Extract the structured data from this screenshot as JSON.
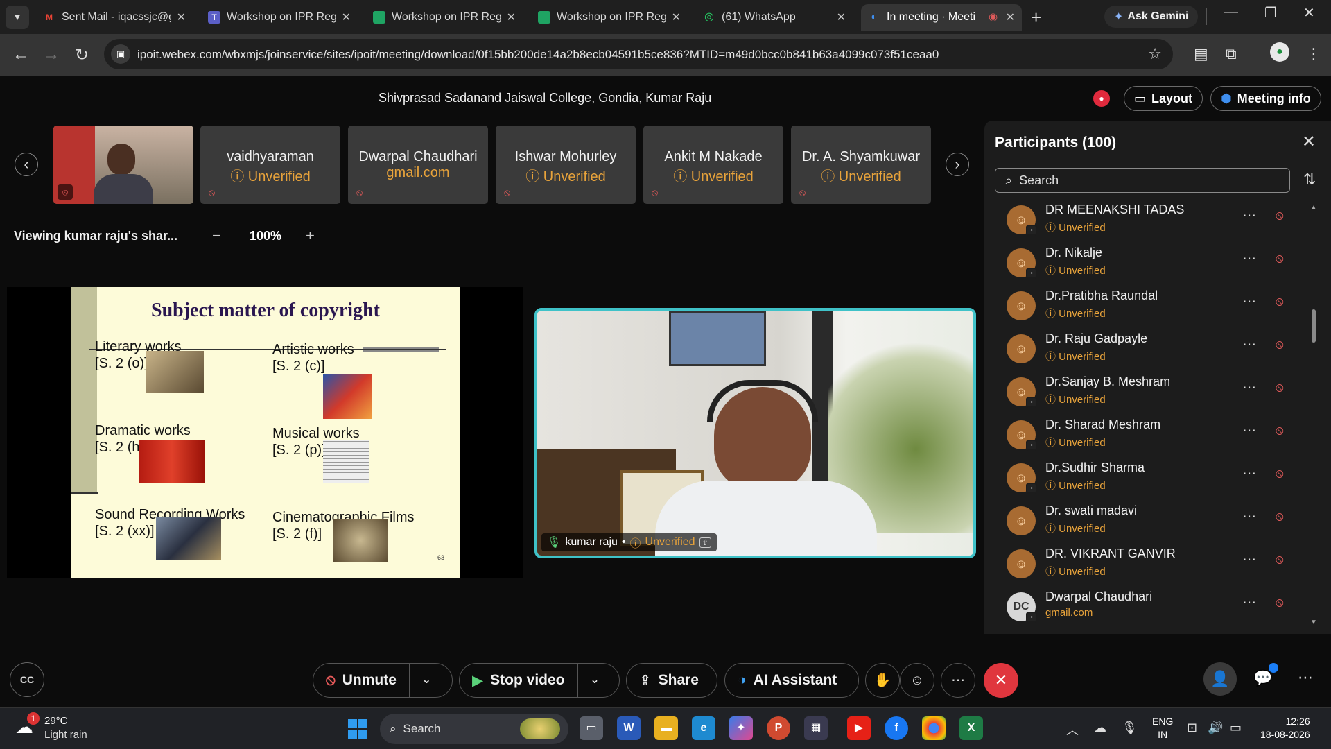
{
  "browser": {
    "tabs": [
      {
        "title": "Sent Mail - iqacssjc@g",
        "icon": "gmail-icon"
      },
      {
        "title": "Workshop on IPR Regi",
        "icon": "teams-icon"
      },
      {
        "title": "Workshop on IPR Regi",
        "icon": "sheets-icon"
      },
      {
        "title": "Workshop on IPR Regi",
        "icon": "sheets-icon"
      },
      {
        "title": "(61) WhatsApp",
        "icon": "whatsapp-icon"
      },
      {
        "title": "In meeting · Meeti",
        "icon": "webex-icon"
      }
    ],
    "gemini_label": "Ask Gemini",
    "url": "ipoit.webex.com/wbxmjs/joinservice/sites/ipoit/meeting/download/0f15bb200de14a2b8ecb04591b5ce836?MTID=m49d0bcc0b841b63a4099c073f51ceaa0"
  },
  "meeting": {
    "title": "Shivprasad Sadanand Jaiswal College, Gondia, Kumar Raju",
    "layout_label": "Layout",
    "info_label": "Meeting info",
    "filmstrip": [
      {
        "name": "vaidhyaraman",
        "status": "Unverified"
      },
      {
        "name": "Dwarpal Chaudhari",
        "status": "gmail.com"
      },
      {
        "name": "Ishwar Mohurley",
        "status": "Unverified"
      },
      {
        "name": "Ankit M Nakade",
        "status": "Unverified"
      },
      {
        "name": "Dr. A. Shyamkuwar",
        "status": "Unverified"
      }
    ],
    "viewing_label": "Viewing kumar raju's shar...",
    "zoom": "100%",
    "speaker": {
      "name": "kumar raju",
      "separator": "•",
      "status": "Unverified"
    }
  },
  "slide": {
    "title": "Subject matter of copyright",
    "items": [
      {
        "line1": "Literary works",
        "line2": "[S. 2 (o)]"
      },
      {
        "line1": "Artistic works",
        "line2": "[S. 2 (c)]"
      },
      {
        "line1": "Dramatic works",
        "line2": "[S. 2 (h)]"
      },
      {
        "line1": "Musical works",
        "line2": "[S. 2 (p)]"
      },
      {
        "line1": "Sound Recording Works",
        "line2": "[S. 2 (xx)]"
      },
      {
        "line1": "Cinematographic Films",
        "line2": "[S. 2 (f)]"
      }
    ],
    "page": "63"
  },
  "participants": {
    "title": "Participants (100)",
    "search_placeholder": "Search",
    "list": [
      {
        "name": "DR MEENAKSHI TADAS",
        "status": "Unverified"
      },
      {
        "name": "Dr. Nikalje",
        "status": "Unverified"
      },
      {
        "name": "Dr.Pratibha Raundal",
        "status": "Unverified"
      },
      {
        "name": "Dr. Raju Gadpayle",
        "status": "Unverified"
      },
      {
        "name": "Dr.Sanjay B. Meshram",
        "status": "Unverified"
      },
      {
        "name": "Dr. Sharad Meshram",
        "status": "Unverified"
      },
      {
        "name": "Dr.Sudhir Sharma",
        "status": "Unverified"
      },
      {
        "name": "Dr. swati madavi",
        "status": "Unverified"
      },
      {
        "name": "DR. VIKRANT GANVIR",
        "status": "Unverified"
      },
      {
        "name": "Dwarpal Chaudhari",
        "status": "gmail.com",
        "initials": "DC"
      }
    ]
  },
  "controls": {
    "cc": "CC",
    "unmute": "Unmute",
    "stop_video": "Stop video",
    "share": "Share",
    "ai_assistant": "AI Assistant"
  },
  "taskbar": {
    "weather_badge": "1",
    "temp": "29°C",
    "condition": "Light rain",
    "search": "Search",
    "lang1": "ENG",
    "lang2": "IN",
    "time": "12:26",
    "date": "18-08-2026"
  }
}
